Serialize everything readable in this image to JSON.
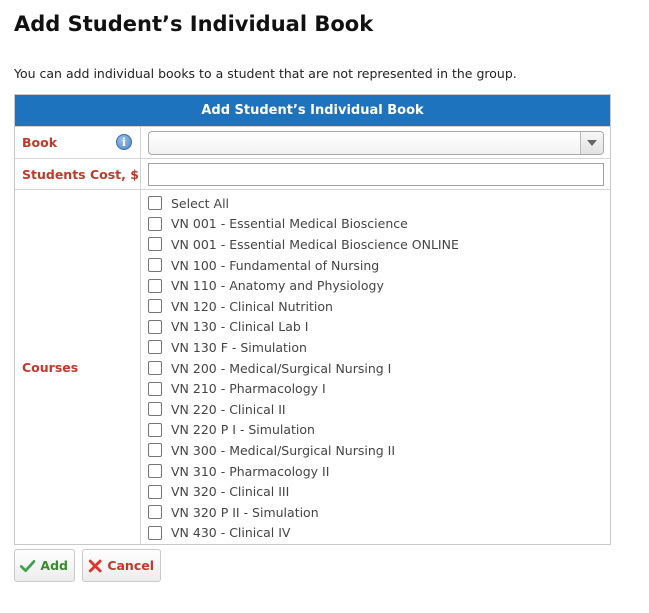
{
  "page": {
    "title": "Add Student’s Individual Book",
    "intro": "You can add individual books to a student that are not represented in the group."
  },
  "panel": {
    "header": "Add Student’s Individual Book",
    "book_label": "Book",
    "book_info_icon": "info-icon",
    "book_value": "",
    "cost_label": "Students Cost, $",
    "cost_value": "",
    "courses_label": "Courses"
  },
  "courses": {
    "select_all": "Select All",
    "items": [
      "VN 001 - Essential Medical Bioscience",
      "VN 001 - Essential Medical Bioscience ONLINE",
      "VN 100 - Fundamental of Nursing",
      "VN 110 - Anatomy and Physiology",
      "VN 120 - Clinical Nutrition",
      "VN 130 - Clinical Lab I",
      "VN 130 F - Simulation",
      "VN 200 - Medical/Surgical Nursing I",
      "VN 210 - Pharmacology I",
      "VN 220 - Clinical II",
      "VN 220 P I - Simulation",
      "VN 300 - Medical/Surgical Nursing II",
      "VN 310 - Pharmacology II",
      "VN 320 - Clinical III",
      "VN 320 P II - Simulation",
      "VN 430 - Clinical IV"
    ]
  },
  "actions": {
    "add_label": "Add",
    "add_icon": "check-icon",
    "cancel_label": "Cancel",
    "cancel_icon": "close-icon"
  },
  "colors": {
    "header_bg": "#1e73be",
    "label_text": "#c0392b",
    "add_text": "#3a8a2e"
  }
}
